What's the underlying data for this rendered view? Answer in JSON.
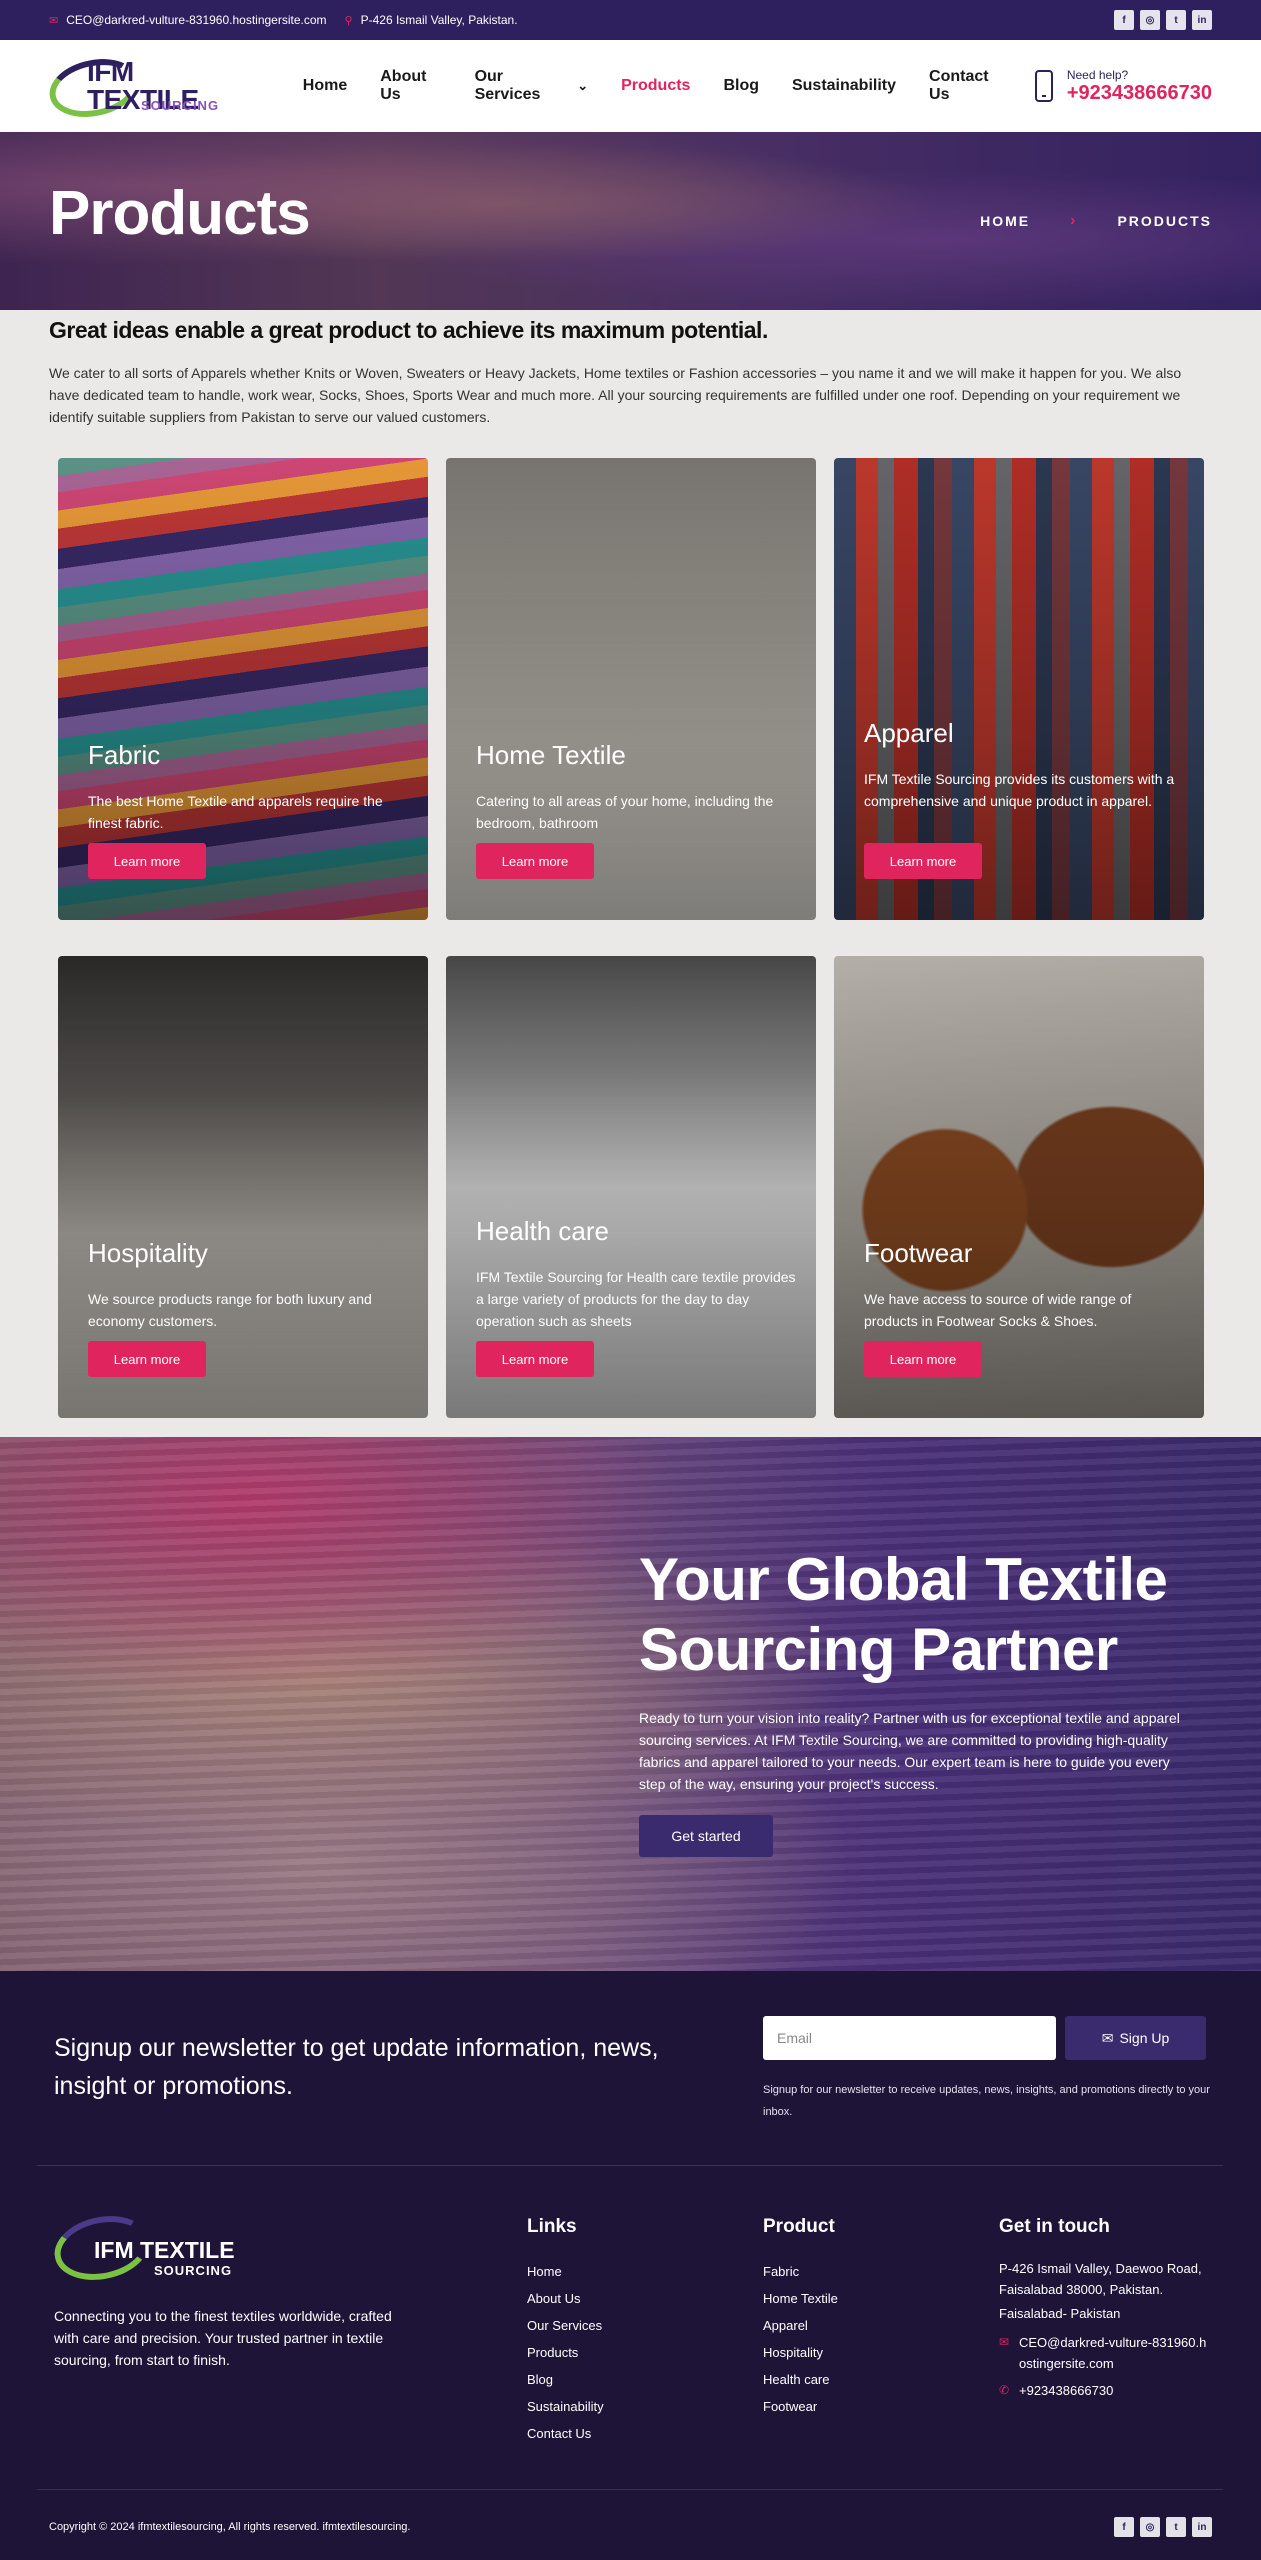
{
  "topbar": {
    "email": "CEO@darkred-vulture-831960.hostingersite.com",
    "address": "P-426 Ismail Valley, Pakistan.",
    "socials": [
      "f",
      "◎",
      "t",
      "in"
    ]
  },
  "header": {
    "logo_main": "IFM TEXTILE",
    "logo_sub": "SOURCING",
    "nav": [
      "Home",
      "About Us",
      "Our Services",
      "Products",
      "Blog",
      "Sustainability",
      "Contact Us"
    ],
    "active": "Products",
    "help_label": "Need help?",
    "help_phone": "+923438666730"
  },
  "hero": {
    "title": "Products",
    "breadcrumb": [
      "HOME",
      "PRODUCTS"
    ]
  },
  "intro": {
    "heading": "Great ideas enable a great product to achieve its maximum potential.",
    "text": "We cater to all sorts of Apparels whether Knits or Woven, Sweaters or Heavy Jackets, Home textiles or Fashion accessories – you name it and we will make it happen for you. We also have dedicated team to handle, work wear, Socks, Shoes, Sports Wear and much more. All your sourcing requirements are fulfilled under one roof. Depending on your requirement we identify suitable suppliers from Pakistan to serve our valued customers."
  },
  "products": [
    {
      "title": "Fabric",
      "desc": "The best Home Textile and apparels require the finest fabric.",
      "button": "Learn more"
    },
    {
      "title": "Home Textile",
      "desc": "Catering to all areas of your home, including the bedroom, bathroom",
      "button": "Learn more"
    },
    {
      "title": "Apparel",
      "desc": "IFM Textile Sourcing provides its customers with a comprehensive and unique product in apparel.",
      "button": "Learn more"
    },
    {
      "title": "Hospitality",
      "desc": "We source products range for both luxury and economy customers.",
      "button": "Learn more"
    },
    {
      "title": "Health care",
      "desc": "IFM Textile Sourcing for Health care textile provides a large variety of products for the day to day operation such as sheets",
      "button": "Learn more"
    },
    {
      "title": "Footwear",
      "desc": "We have access to source of wide range of products in Footwear Socks & Shoes.",
      "button": "Learn more"
    }
  ],
  "partner": {
    "title": "Your Global Textile Sourcing Partner",
    "text": "Ready to turn your vision into reality? Partner with us for exceptional textile and apparel sourcing services. At IFM Textile Sourcing, we are committed to providing high-quality fabrics and apparel tailored to your needs. Our expert team is here to guide you every step of the way, ensuring your project's success.",
    "button": "Get started"
  },
  "newsletter": {
    "title": "Signup our newsletter to get update information, news, insight or promotions.",
    "placeholder": "Email",
    "button": "Sign Up",
    "note": "Signup for our newsletter to receive updates, news, insights, and promotions directly to your inbox."
  },
  "footer": {
    "logo_main": "IFM TEXTILE",
    "logo_sub": "SOURCING",
    "tagline": "Connecting you to the finest textiles worldwide, crafted with care and precision. Your trusted partner in textile sourcing, from start to finish.",
    "links_title": "Links",
    "links": [
      "Home",
      "About Us",
      "Our Services",
      "Products",
      "Blog",
      "Sustainability",
      "Contact Us"
    ],
    "product_title": "Product",
    "product_links": [
      "Fabric",
      "Home Textile",
      "Apparel",
      "Hospitality",
      "Health care",
      "Footwear"
    ],
    "contact_title": "Get in touch",
    "address": "P-426 Ismail Valley, Daewoo Road, Faisalabad 38000, Pakistan.",
    "address2": "Faisalabad- Pakistan",
    "email": "CEO@darkred-vulture-831960.hostingersite.com",
    "phone": "+923438666730",
    "copyright": "Copyright © 2024 ifmtextilesourcing, All rights reserved. ifmtextilesourcing."
  },
  "colors": {
    "brand": "#2e1f5e",
    "accent": "#e0245e",
    "green": "#7bc143"
  }
}
